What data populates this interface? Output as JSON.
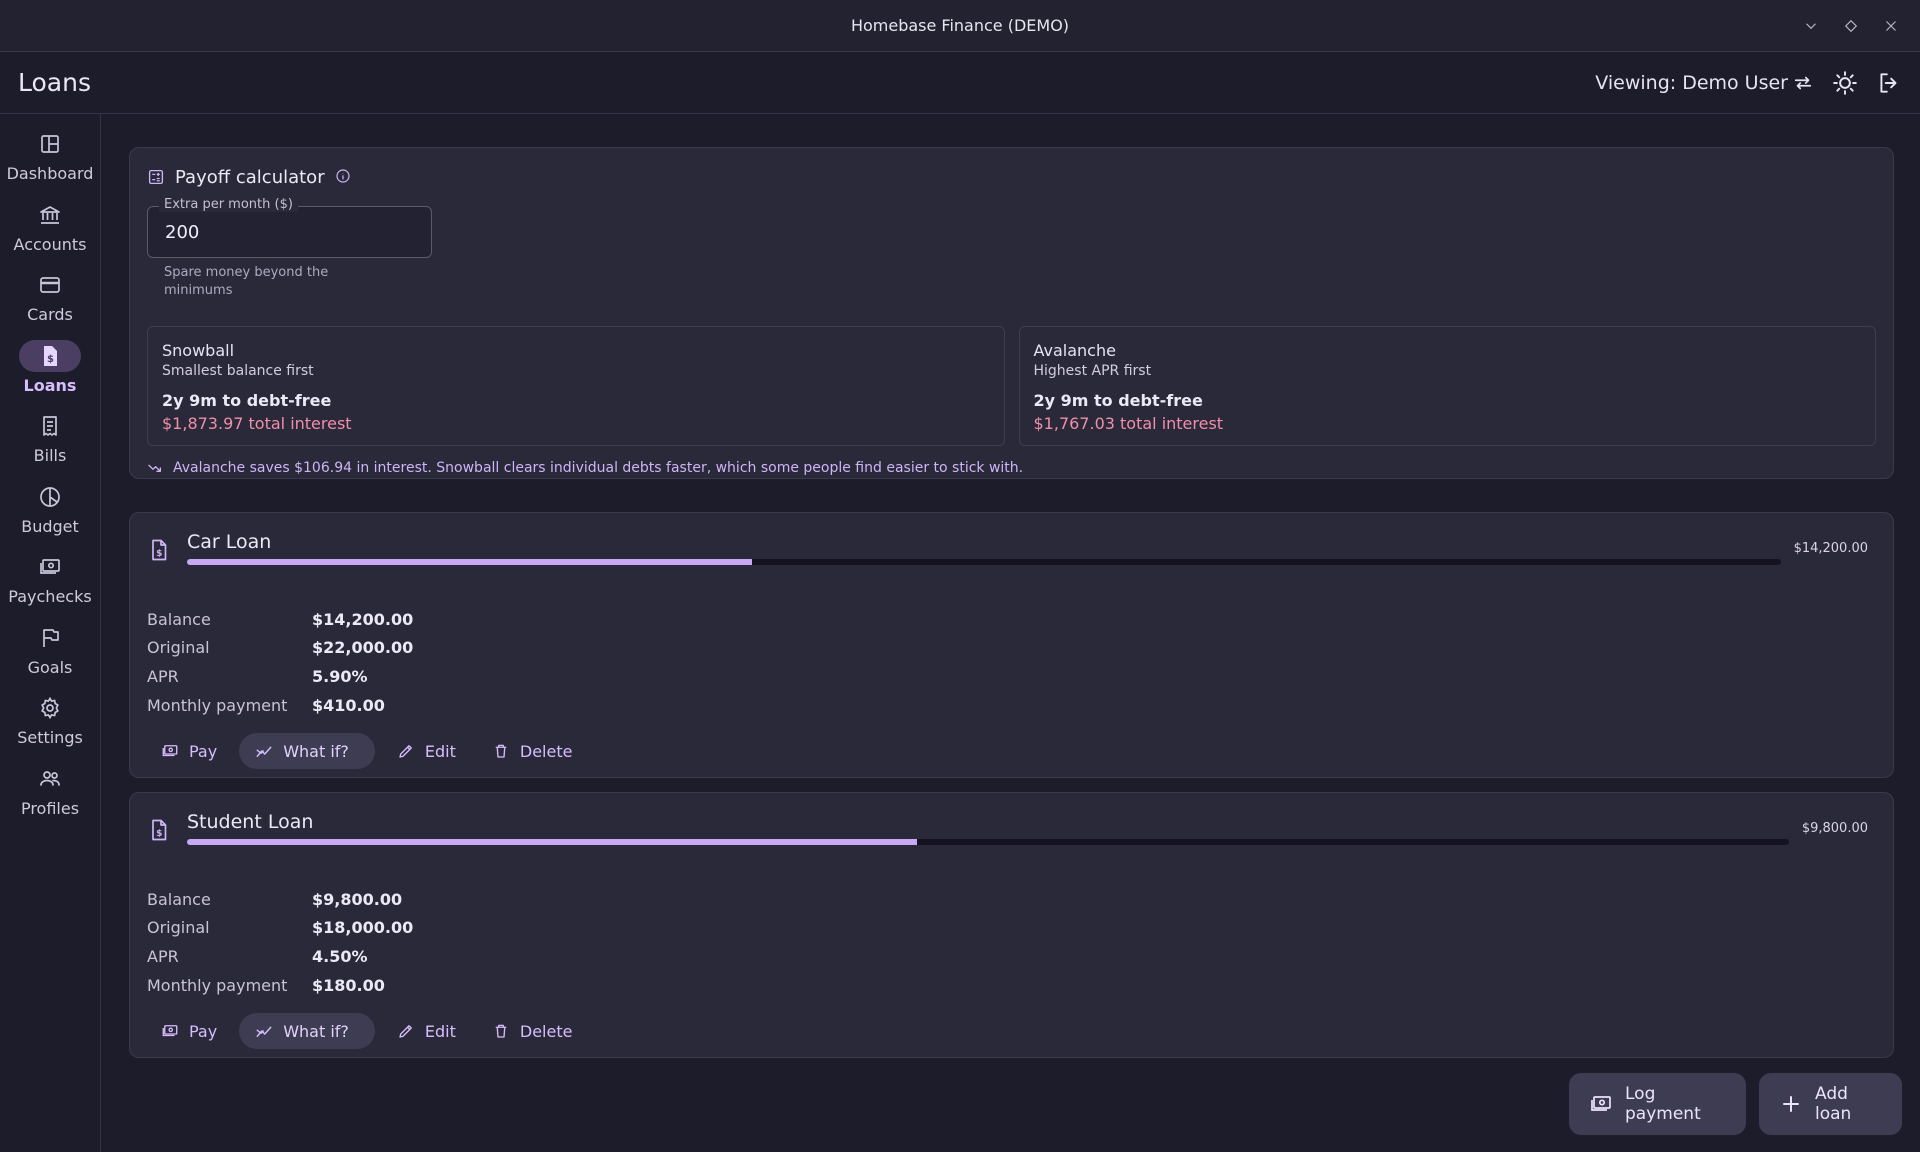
{
  "window": {
    "title": "Homebase Finance (DEMO)"
  },
  "appbar": {
    "title": "Loans",
    "viewing": "Viewing: Demo User"
  },
  "sidebar": {
    "items": [
      {
        "label": "Dashboard",
        "icon": "dashboard-icon"
      },
      {
        "label": "Accounts",
        "icon": "bank-icon"
      },
      {
        "label": "Cards",
        "icon": "credit-card-icon"
      },
      {
        "label": "Loans",
        "icon": "loan-document-icon",
        "active": true
      },
      {
        "label": "Bills",
        "icon": "receipt-icon"
      },
      {
        "label": "Budget",
        "icon": "pie-chart-icon"
      },
      {
        "label": "Paychecks",
        "icon": "cash-icon"
      },
      {
        "label": "Goals",
        "icon": "flag-icon"
      },
      {
        "label": "Settings",
        "icon": "gear-icon"
      },
      {
        "label": "Profiles",
        "icon": "people-icon"
      }
    ]
  },
  "calculator": {
    "title": "Payoff calculator",
    "field_label": "Extra per month ($)",
    "field_value": "200",
    "hint": "Spare money beyond the minimums",
    "snowball": {
      "name": "Snowball",
      "sub": "Smallest balance first",
      "time": "2y 9m to debt-free",
      "interest": "$1,873.97 total interest"
    },
    "avalanche": {
      "name": "Avalanche",
      "sub": "Highest APR first",
      "time": "2y 9m to debt-free",
      "interest": "$1,767.03 total interest"
    },
    "note": "Avalanche saves $106.94 in interest. Snowball clears individual debts faster, which some people find easier to stick with."
  },
  "labels": {
    "balance": "Balance",
    "original": "Original",
    "apr": "APR",
    "monthly": "Monthly payment",
    "pay": "Pay",
    "whatif": "What if?",
    "edit": "Edit",
    "delete": "Delete"
  },
  "loans": [
    {
      "name": "Car Loan",
      "amount": "$14,200.00",
      "balance": "$14,200.00",
      "original": "$22,000.00",
      "apr": "5.90%",
      "monthly": "$410.00",
      "paid_fraction": 0.3545
    },
    {
      "name": "Student Loan",
      "amount": "$9,800.00",
      "balance": "$9,800.00",
      "original": "$18,000.00",
      "apr": "4.50%",
      "monthly": "$180.00",
      "paid_fraction": 0.4556
    }
  ],
  "fab": {
    "log_payment": "Log payment",
    "add_loan": "Add loan"
  },
  "colors": {
    "accent": "#c9a8f6",
    "interest": "#f08fa9",
    "background": "#1d1c2b",
    "card": "#2a2939"
  }
}
